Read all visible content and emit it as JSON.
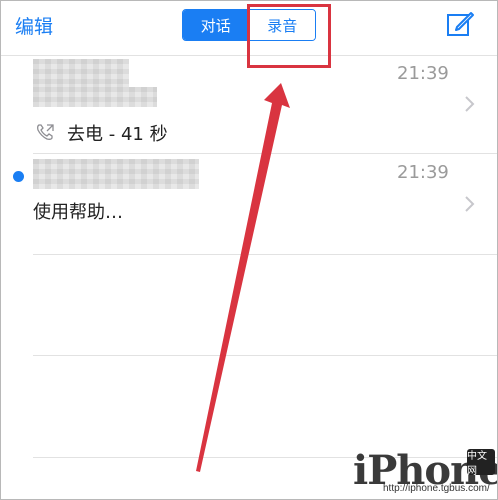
{
  "nav": {
    "edit_label": "编辑",
    "segments": [
      "对话",
      "录音"
    ],
    "active_segment": "对话"
  },
  "rows": [
    {
      "time": "21:39",
      "subtitle": "去电 - 41 秒",
      "unread": false,
      "call_icon": "outgoing-call-icon"
    },
    {
      "time": "21:39",
      "subtitle": "使用帮助…",
      "unread": true
    }
  ],
  "colors": {
    "accent": "#1a7ef3",
    "annotation": "#d93440",
    "separator": "#e2e2e2",
    "time_text": "#9a9a9a"
  },
  "watermark": {
    "brand": "iPhone",
    "badge": "中文网",
    "url": "http://iphone.tgbus.com/"
  }
}
